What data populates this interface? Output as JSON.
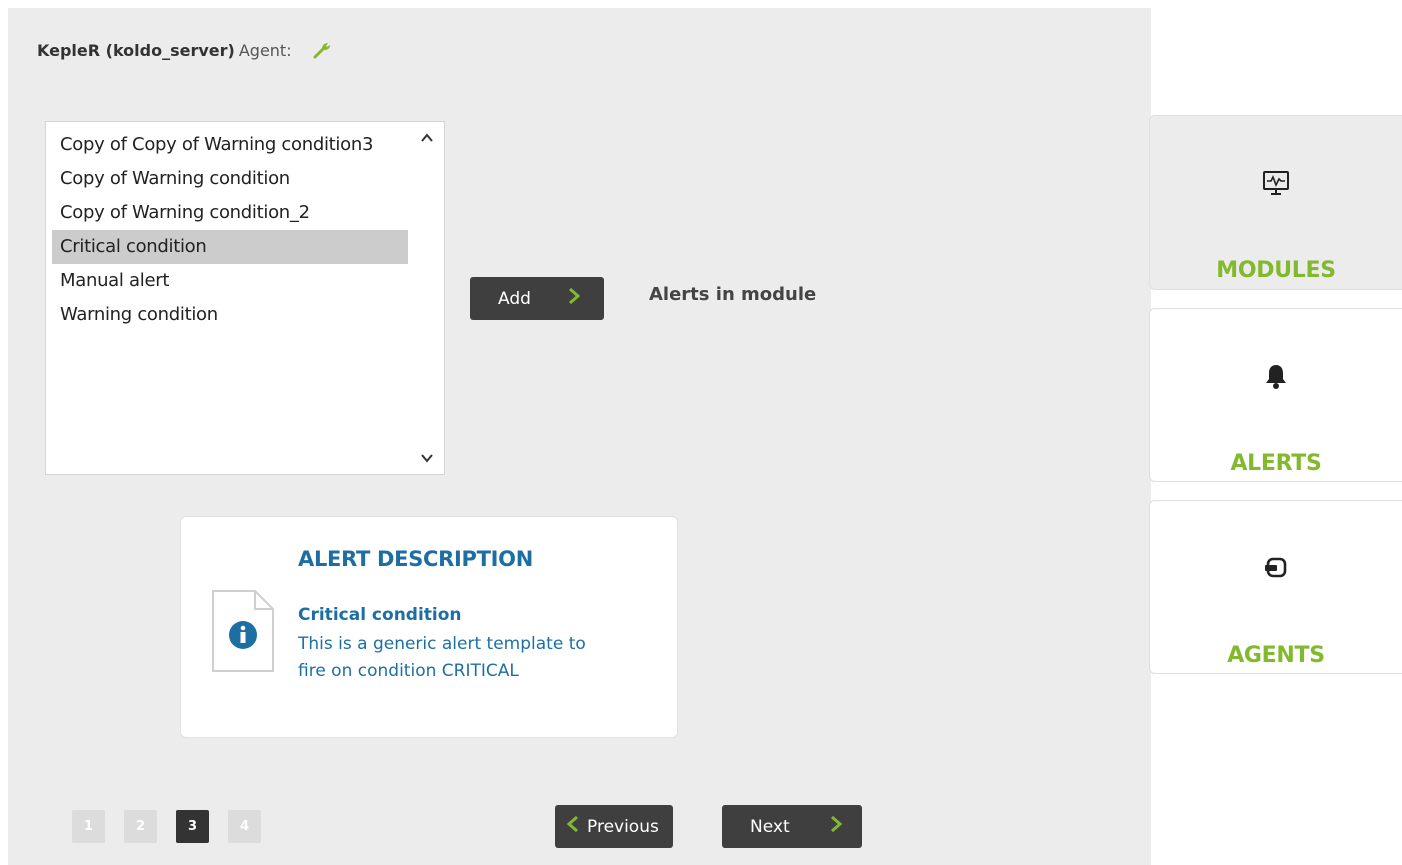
{
  "header": {
    "agent_name": "KepleR (koldo_server)",
    "agent_label": "Agent:"
  },
  "alert_templates": {
    "items": [
      "Copy of Copy of Warning condition3",
      "Copy of Warning condition",
      "Copy of Warning condition_2",
      "Critical condition",
      "Manual alert",
      "Warning condition"
    ],
    "selected": "Critical condition"
  },
  "actions": {
    "add_label": "Add"
  },
  "module_alerts": {
    "heading": "Alerts in module"
  },
  "description": {
    "title": "ALERT DESCRIPTION",
    "name": "Critical condition",
    "text": "This is a generic alert template to fire on condition CRITICAL"
  },
  "pagination": {
    "pages": [
      "1",
      "2",
      "3",
      "4"
    ],
    "current": "3",
    "previous_label": "Previous",
    "next_label": "Next"
  },
  "side_tabs": [
    {
      "label": "MODULES",
      "icon": "monitor-icon",
      "active": true
    },
    {
      "label": "ALERTS",
      "icon": "bell-icon",
      "active": false
    },
    {
      "label": "AGENTS",
      "icon": "agent-icon",
      "active": false
    }
  ],
  "colors": {
    "accent_green": "#82b92e",
    "description_blue": "#1d6fa3",
    "button_dark": "#3f3f3f"
  }
}
